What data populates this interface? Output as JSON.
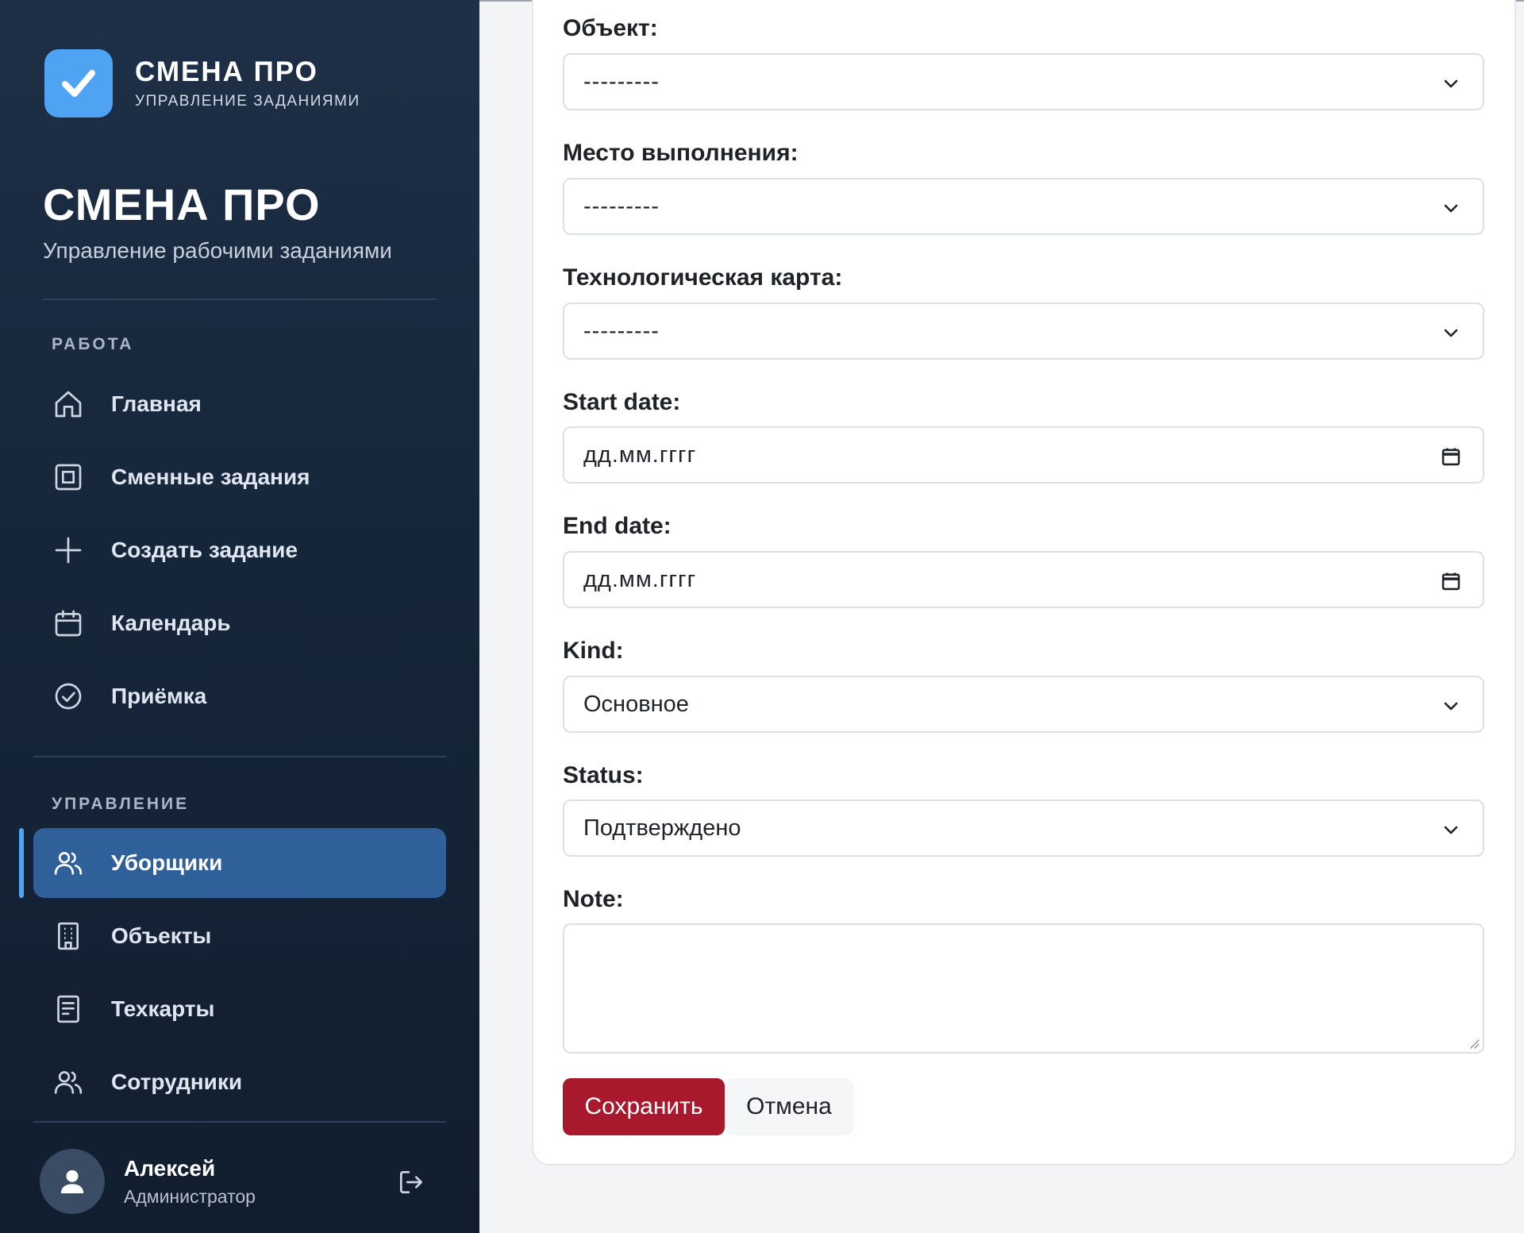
{
  "brand": {
    "name": "СМЕНА ПРО",
    "subtitle": "УПРАВЛЕНИЕ ЗАДАНИЯМИ"
  },
  "hero": {
    "title": "СМЕНА ПРО",
    "subtitle": "Управление рабочими заданиями"
  },
  "sidebar": {
    "sections": [
      {
        "label": "РАБОТА",
        "items": [
          {
            "label": "Главная",
            "icon": "home-icon"
          },
          {
            "label": "Сменные задания",
            "icon": "task-square-icon"
          },
          {
            "label": "Создать задание",
            "icon": "plus-icon"
          },
          {
            "label": "Календарь",
            "icon": "calendar-icon"
          },
          {
            "label": "Приёмка",
            "icon": "check-circle-icon"
          }
        ]
      },
      {
        "label": "УПРАВЛЕНИЕ",
        "items": [
          {
            "label": "Уборщики",
            "icon": "users-icon",
            "active": true
          },
          {
            "label": "Объекты",
            "icon": "building-icon"
          },
          {
            "label": "Техкарты",
            "icon": "document-icon"
          },
          {
            "label": "Сотрудники",
            "icon": "users-icon"
          }
        ]
      }
    ]
  },
  "user": {
    "name": "Алексей",
    "role": "Администратор"
  },
  "form": {
    "fields": [
      {
        "label": "Объект:",
        "value": "---------",
        "type": "select"
      },
      {
        "label": "Место выполнения:",
        "value": "---------",
        "type": "select"
      },
      {
        "label": "Технологическая карта:",
        "value": "---------",
        "type": "select"
      },
      {
        "label": "Start date:",
        "value": "дд.мм.гггг",
        "type": "date"
      },
      {
        "label": "End date:",
        "value": "дд.мм.гггг",
        "type": "date"
      },
      {
        "label": "Kind:",
        "value": "Основное",
        "type": "select"
      },
      {
        "label": "Status:",
        "value": "Подтверждено",
        "type": "select"
      }
    ],
    "note_label": "Note:",
    "note_value": "",
    "save_label": "Сохранить",
    "cancel_label": "Отмена"
  },
  "colors": {
    "sidebar_bg": "#16263a",
    "accent": "#4ea3f2",
    "active_item": "#30609a",
    "primary_button": "#a8192e"
  }
}
